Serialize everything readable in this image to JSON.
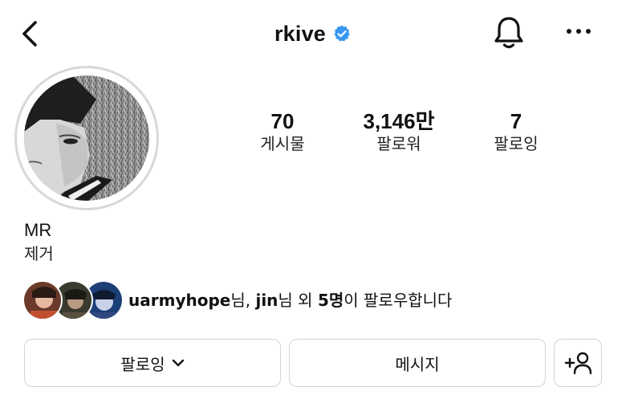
{
  "header": {
    "username": "rkive",
    "verified": true,
    "accent": "#3897f0",
    "icons": [
      "back-arrow-icon",
      "verified-badge-icon",
      "bell-icon",
      "more-horizontal-icon"
    ]
  },
  "stats": [
    {
      "value": "70",
      "label": "게시물"
    },
    {
      "value": "3,146만",
      "label": "팔로워"
    },
    {
      "value": "7",
      "label": "팔로잉"
    }
  ],
  "profile": {
    "name": "MR",
    "bio": "제거"
  },
  "followed_by": {
    "user1": "uarmyhope",
    "suffix1": "님, ",
    "user2": "jin",
    "suffix2": "님 외 ",
    "count": "5명",
    "suffix3": "이 팔로우합니다"
  },
  "buttons": {
    "following": "팔로잉",
    "message": "메시지",
    "add_user_icon": "add-user-icon"
  }
}
